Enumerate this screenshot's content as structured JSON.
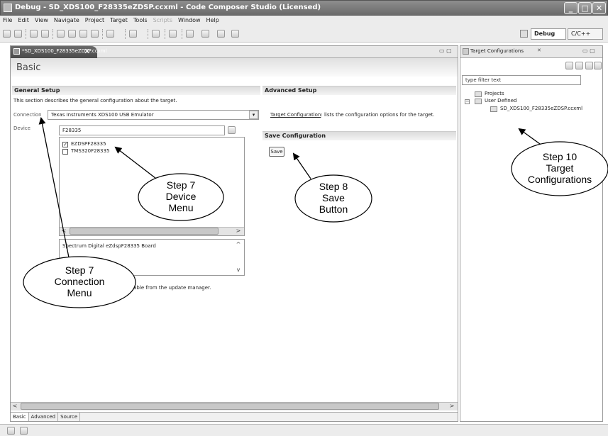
{
  "window": {
    "title": "Debug - SD_XDS100_F28335eZDSP.ccxml - Code Composer Studio (Licensed)",
    "buttons": {
      "minimize": "_",
      "maximize": "□",
      "close": "✕"
    }
  },
  "menubar": {
    "items": [
      "File",
      "Edit",
      "View",
      "Navigate",
      "Project",
      "Target",
      "Tools",
      "Scripts",
      "Window",
      "Help"
    ],
    "disabled": "Scripts"
  },
  "toolbar": {
    "perspectives": {
      "debug": "Debug",
      "cpp": "C/C++"
    }
  },
  "editor": {
    "tab_label": "*SD_XDS100_F28335eZDSP.ccxml",
    "tab_close": "✕",
    "minmax": "▭ ▢",
    "page_title": "Basic",
    "general_setup": {
      "heading": "General Setup",
      "description": "This section describes the general configuration about the target.",
      "connection_label": "Connection",
      "connection_value": "Texas Instruments XDS100 USB Emulator",
      "device_label": "Device",
      "device_value": "F28335",
      "devices": [
        {
          "label": "EZDSPF28335",
          "checked": true
        },
        {
          "label": "TMS320F28335",
          "checked": false
        }
      ],
      "device_description": "Spectrum Digital eZdspF28335 Board",
      "update_note": "e available from the update manager."
    },
    "advanced_setup": {
      "heading": "Advanced Setup",
      "link_text": "Target Configuration",
      "link_suffix": ": lists the configuration options for the target."
    },
    "save_configuration": {
      "heading": "Save Configuration",
      "button_label": "Save"
    },
    "bottom_tabs": [
      "Basic",
      "Advanced",
      "Source"
    ]
  },
  "target_view": {
    "tab_label": "Target Configurations",
    "tab_close": "✕",
    "filter_placeholder": "type filter text",
    "tree": {
      "projects": "Projects",
      "user_defined": "User Defined",
      "file": "SD_XDS100_F28335eZDSP.ccxml",
      "expand_symbol": "−"
    }
  },
  "callouts": {
    "step7_device": [
      "Step 7",
      "Device",
      "Menu"
    ],
    "step8_save": [
      "Step 8",
      "Save",
      "Button"
    ],
    "step10_target": [
      "Step 10",
      "Target",
      "Configurations"
    ],
    "step7_connection": [
      "Step 7",
      "Connection",
      "Menu"
    ]
  },
  "scroll_arrows": {
    "left": "<",
    "right": ">",
    "up": "^",
    "down": "v"
  }
}
